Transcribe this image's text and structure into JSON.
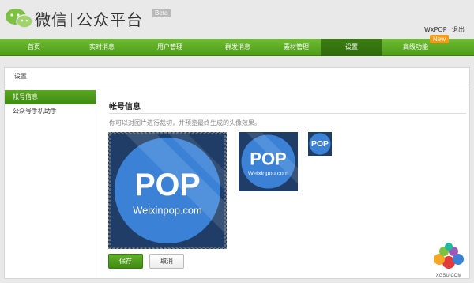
{
  "header": {
    "brand_left": "微信",
    "brand_right": "公众平台",
    "beta": "Beta",
    "username": "WxPOP",
    "logout": "退出"
  },
  "nav": {
    "items": [
      "首页",
      "实时消息",
      "用户管理",
      "群发消息",
      "素材管理",
      "设置",
      "高级功能"
    ],
    "active_index": 5,
    "new_badge": "New"
  },
  "breadcrumb": "设置",
  "sidebar": {
    "items": [
      "帐号信息",
      "公众号手机助手"
    ],
    "active_index": 0
  },
  "content": {
    "title": "帐号信息",
    "hint": "你可以对图片进行裁切，并预览最终生成的头像效果。"
  },
  "avatar": {
    "main_text": "POP",
    "sub_text": "Weixinpop.com",
    "bg_color": "#1f3d66",
    "circle_color": "#3b82d6"
  },
  "buttons": {
    "save": "保存",
    "cancel": "取消"
  },
  "watermark": {
    "text": "XGSU.COM"
  },
  "colors": {
    "nav_green": "#5aa822",
    "nav_active": "#2f6a0c",
    "badge_orange": "#f39c12"
  }
}
